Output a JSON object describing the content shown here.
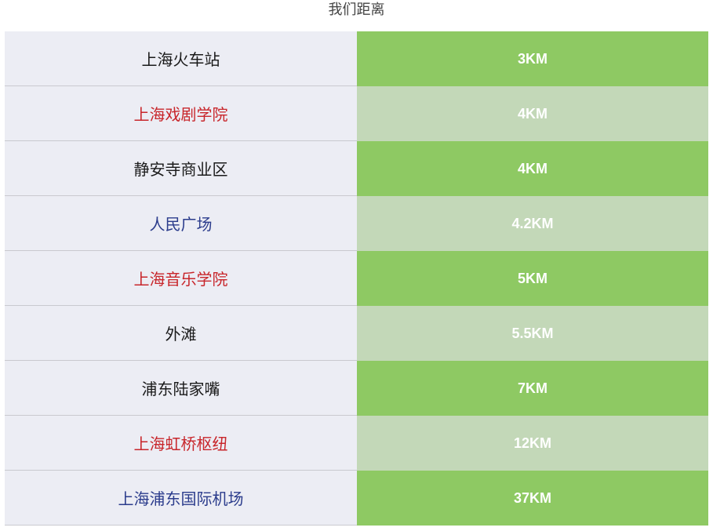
{
  "title": "我们距离",
  "colors": {
    "name_bg": "#ecedf4",
    "dist_bg_strong": "#8ec963",
    "dist_bg_light": "#c3d8b8",
    "text_black": "#1a1a1a",
    "text_red": "#c8262b",
    "text_blue": "#2b3c8c"
  },
  "rows": [
    {
      "name": "上海火车站",
      "distance": "3KM",
      "name_color": "black"
    },
    {
      "name": "上海戏剧学院",
      "distance": "4KM",
      "name_color": "red"
    },
    {
      "name": "静安寺商业区",
      "distance": "4KM",
      "name_color": "black"
    },
    {
      "name": "人民广场",
      "distance": "4.2KM",
      "name_color": "blue"
    },
    {
      "name": "上海音乐学院",
      "distance": "5KM",
      "name_color": "red"
    },
    {
      "name": "外滩",
      "distance": "5.5KM",
      "name_color": "black"
    },
    {
      "name": "浦东陆家嘴",
      "distance": "7KM",
      "name_color": "black"
    },
    {
      "name": "上海虹桥枢纽",
      "distance": "12KM",
      "name_color": "red"
    },
    {
      "name": "上海浦东国际机场",
      "distance": "37KM",
      "name_color": "blue"
    }
  ]
}
